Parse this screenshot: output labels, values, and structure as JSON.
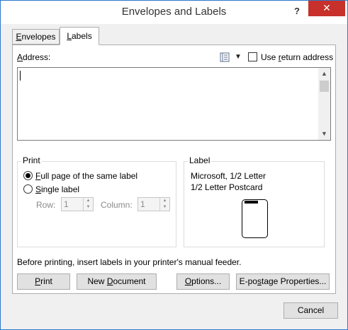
{
  "window": {
    "title": "Envelopes and Labels",
    "help_label": "?",
    "close_label": "✕",
    "close_color": "#c7302b"
  },
  "tabs": [
    {
      "label": "Envelopes",
      "mnemonic": "E",
      "rest": "nvelopes",
      "selected": false
    },
    {
      "label": "Labels",
      "mnemonic": "L",
      "rest": "abels",
      "selected": true
    }
  ],
  "address": {
    "label_mnemonic": "A",
    "label_rest": "ddress:",
    "value": "",
    "insert_address_icon": "address-book-icon",
    "dropdown_arrow": "▼",
    "use_return_address": {
      "pre": "Use ",
      "mnemonic": "r",
      "rest": "eturn address",
      "checked": false
    }
  },
  "print_group": {
    "title": "Print",
    "full_page": {
      "mnemonic": "F",
      "rest": "ull page of the same label",
      "checked": true
    },
    "single_label": {
      "mnemonic": "S",
      "rest": "ingle label",
      "checked": false
    },
    "row_label": "Row:",
    "row_value": "1",
    "column_label": "Column:",
    "column_value": "1",
    "spin_up": "▲",
    "spin_down": "▼"
  },
  "label_group": {
    "title": "Label",
    "line1": "Microsoft, 1/2 Letter",
    "line2": "1/2 Letter Postcard"
  },
  "note": "Before printing, insert labels in your printer's manual feeder.",
  "buttons": {
    "print": {
      "mnemonic": "P",
      "rest": "rint"
    },
    "new_document": {
      "pre": "New ",
      "mnemonic": "D",
      "rest": "ocument"
    },
    "options": {
      "mnemonic": "O",
      "rest": "ptions..."
    },
    "epostage": {
      "pre": "E-po",
      "mnemonic": "s",
      "rest": "tage Properties..."
    },
    "cancel": "Cancel"
  }
}
